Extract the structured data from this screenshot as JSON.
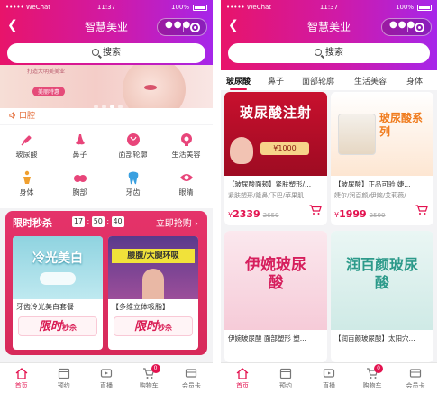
{
  "colors": {
    "accent": "#e3124f",
    "gradient_start": "#e8146a",
    "gradient_end": "#a626ea",
    "flash_bg": "#e5336a",
    "notice_orange": "#e36a35"
  },
  "status": {
    "carrier": "••••• WeChat",
    "wifi_icon": "wifi-icon",
    "time": "11:37",
    "battery": "100%"
  },
  "left": {
    "nav": {
      "back_icon": "chevron-left-icon",
      "title": "智慧美业",
      "more_icon": "more-dots-icon",
      "close_icon": "target-circle-icon"
    },
    "search": {
      "label": "搜索"
    },
    "banner": {
      "tag": "打造大明美美业",
      "cta": "美丽特惠",
      "slide_count": 4
    },
    "notice": {
      "icon": "speaker-icon",
      "text": "口腔"
    },
    "categories": [
      {
        "label": "玻尿酸",
        "icon": "syringe-icon",
        "color": "#e8457a"
      },
      {
        "label": "鼻子",
        "icon": "nose-icon",
        "color": "#e8457a"
      },
      {
        "label": "面部轮廓",
        "icon": "face-icon",
        "color": "#e8457a"
      },
      {
        "label": "生活美容",
        "icon": "beauty-icon",
        "color": "#e8457a"
      },
      {
        "label": "身体",
        "icon": "body-icon",
        "color": "#f0a030"
      },
      {
        "label": "胸部",
        "icon": "chest-icon",
        "color": "#e8457a"
      },
      {
        "label": "牙齿",
        "icon": "tooth-icon",
        "color": "#3aa0e0"
      },
      {
        "label": "眼睛",
        "icon": "eye-icon",
        "color": "#e8457a"
      }
    ],
    "flash_sale": {
      "title": "限时秒杀",
      "hours": "17",
      "minutes": "50",
      "seconds": "40",
      "more": "立即抢购",
      "more_icon": "chevron-right-icon",
      "items": [
        {
          "name": "牙齿冷光美白套餐",
          "image_text": "冷光美白",
          "badge": "限时",
          "badge_small": "秒杀"
        },
        {
          "name": "【多维立体吸脂】",
          "image_text": "腰腹/大腿环吸",
          "badge": "限时",
          "badge_small": "秒杀"
        }
      ]
    }
  },
  "right": {
    "nav": {
      "back_icon": "chevron-left-icon",
      "title": "智慧美业",
      "more_icon": "more-dots-icon",
      "close_icon": "target-circle-icon"
    },
    "search": {
      "label": "搜索"
    },
    "tabs": [
      "玻尿酸",
      "鼻子",
      "面部轮廓",
      "生活美容",
      "身体"
    ],
    "active_tab": "玻尿酸",
    "products": [
      {
        "image_title": "玻尿酸注射",
        "image_sub": "¥1000",
        "name": "【玻尿酸面颊】紧肤塑形/...",
        "sub": "紧肤塑形/隆鼻/下巴/苹果肌...",
        "currency": "¥",
        "price": "2339",
        "old_price": "2659",
        "cart_icon": "cart-icon"
      },
      {
        "image_title": "玻尿酸系列",
        "image_sub": "",
        "name": "【玻尿酸】正品可验 婕...",
        "sub": "婕尔/润百颜/伊婉/艾莉薇/...",
        "currency": "¥",
        "price": "1999",
        "old_price": "2599",
        "cart_icon": "cart-icon"
      },
      {
        "image_title": "伊婉玻尿酸",
        "image_sub": "",
        "name": "伊婉玻尿酸 面部塑形 塑...",
        "sub": "",
        "currency": "",
        "price": "",
        "old_price": "",
        "cart_icon": ""
      },
      {
        "image_title": "润百颜玻尿酸",
        "image_sub": "",
        "name": "【润百颜玻尿酸】太阳穴...",
        "sub": "",
        "currency": "",
        "price": "",
        "old_price": "",
        "cart_icon": ""
      }
    ]
  },
  "tabbar": [
    {
      "label": "首页",
      "icon": "home-icon",
      "active": true
    },
    {
      "label": "预约",
      "icon": "calendar-icon",
      "active": false
    },
    {
      "label": "直播",
      "icon": "video-icon",
      "active": false
    },
    {
      "label": "购物车",
      "icon": "cart-icon",
      "active": false,
      "badge": "0"
    },
    {
      "label": "会员卡",
      "icon": "member-card-icon",
      "active": false
    }
  ]
}
